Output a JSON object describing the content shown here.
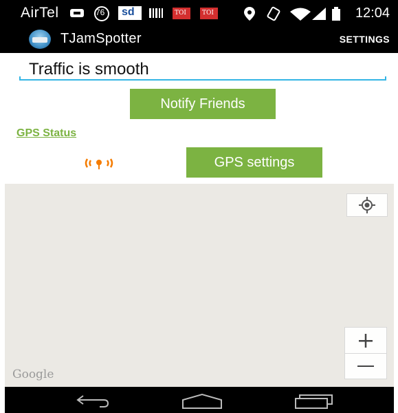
{
  "status_bar": {
    "carrier": "AirTel",
    "badge_number": "76",
    "sd_label": "sd",
    "toi_label_1": "TOI",
    "toi_label_2": "TOI",
    "time": "12:04"
  },
  "action_bar": {
    "title": "TJamSpotter",
    "settings_label": "SETTINGS"
  },
  "content": {
    "status_field_value": "Traffic is smooth",
    "notify_button_label": "Notify Friends",
    "gps_status_link": "GPS Status",
    "gps_settings_button_label": "GPS settings"
  },
  "map": {
    "attribution": "Google",
    "zoom_in_label": "+",
    "zoom_out_label": "—",
    "background_color": "#ebe9e4"
  },
  "colors": {
    "accent_green": "#7cb342",
    "field_underline": "#33b5e5",
    "gps_icon_orange": "#f57c00"
  },
  "icons": [
    "back-icon",
    "home-icon",
    "recents-icon",
    "gps-signal-icon",
    "my-location-icon",
    "wifi-icon",
    "signal-icon",
    "battery-icon",
    "location-pin-icon"
  ]
}
